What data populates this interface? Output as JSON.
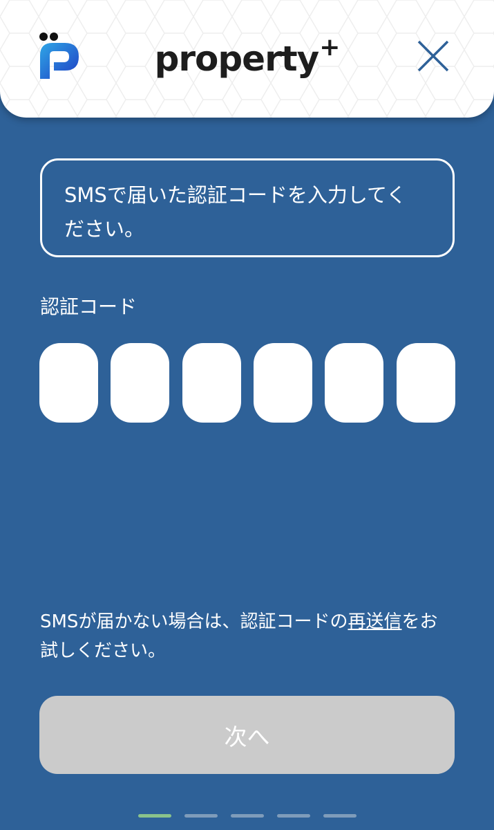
{
  "header": {
    "brand": "property",
    "brand_plus": "+",
    "logo_icon": "property-p-logo",
    "close_icon": "close-x"
  },
  "notice": {
    "line1": "SMSで届いた認証コードを入力してく",
    "line2": "ださい。"
  },
  "code": {
    "label": "認証コード",
    "digits": [
      "",
      "",
      "",
      "",
      "",
      ""
    ]
  },
  "help": {
    "before": "SMSが届かない場合は、認証コードの",
    "link": "再送信",
    "after1": "をお",
    "after2": "試しください。"
  },
  "next_button": {
    "label": "次へ",
    "disabled": true
  },
  "steps": {
    "total": 5,
    "current": 1
  },
  "colors": {
    "background": "#2e6198",
    "button_disabled": "#cbcbcb",
    "step_active": "#8ac28b",
    "step_inactive": "#7f9cba",
    "logo_blue": "#2a5bd7"
  }
}
